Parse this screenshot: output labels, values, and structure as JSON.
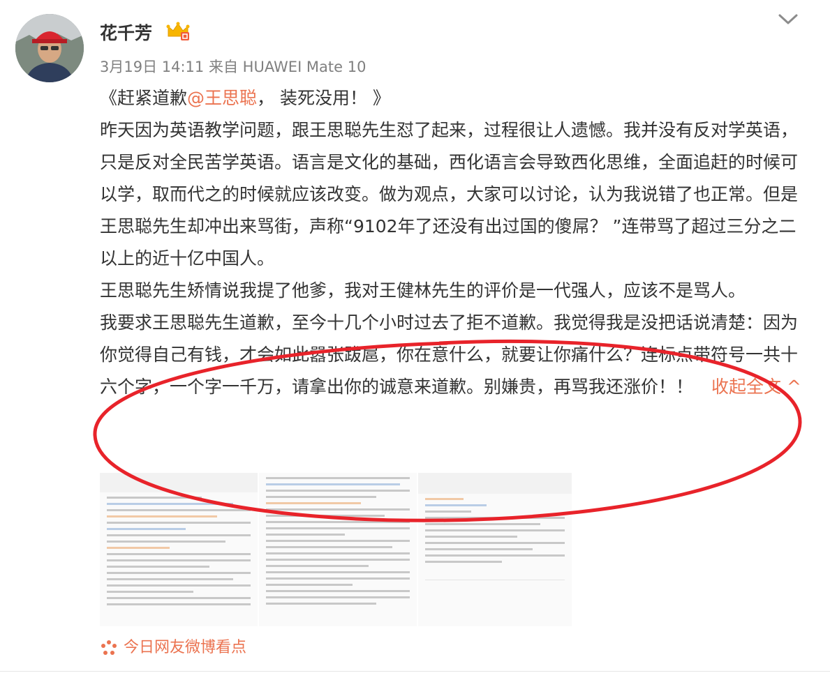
{
  "post": {
    "username": "花千芳",
    "date": "3月19日 14:11",
    "source_prefix": "来自",
    "source_device": "HUAWEI Mate 10",
    "title_prefix": "《赶紧道歉",
    "title_mention": "@王思聪",
    "title_suffix": "，  装死没用！  》",
    "paragraph1": "昨天因为英语教学问题，跟王思聪先生怼了起来，过程很让人遗憾。我并没有反对学英语，只是反对全民苦学英语。语言是文化的基础，西化语言会导致西化思维，全面追赶的时候可以学，取而代之的时候就应该改变。做为观点，大家可以讨论，认为我说错了也正常。但是王思聪先生却冲出来骂街，声称“9102年了还没有出过国的傻屌？ ”连带骂了超过三分之二以上的近十亿中国人。",
    "paragraph2": "王思聪先生矫情说我提了他爹，我对王健林先生的评价是一代强人，应该不是骂人。",
    "paragraph3": "我要求王思聪先生道歉，至今十几个小时过去了拒不道歉。我觉得我是没把话说清楚：因为你觉得自己有钱，才会如此嚣张跋扈，你在意什么，就要让你痛什么？连标点带符号一共十六个字，一个字一千万，请拿出你的诚意来道歉。别嫌贵，再骂我还涨价！！",
    "collapse_label": "收起全文",
    "collapse_arrow": "^"
  },
  "footer": {
    "hotspot_label": "今日网友微博看点"
  },
  "icons": {
    "crown": "vip-crown-icon",
    "chevron": "chevron-down-icon",
    "hotspot": "hotspot-star-icon"
  },
  "colors": {
    "accent": "#eb7350",
    "text": "#333333",
    "meta": "#808080",
    "annotation": "#e8232a"
  }
}
